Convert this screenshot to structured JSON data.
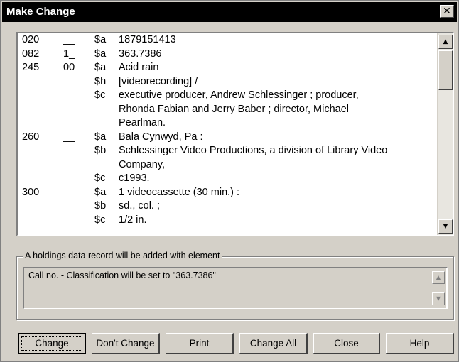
{
  "window": {
    "title": "Make Change",
    "close_glyph": "✕"
  },
  "record": {
    "lines": [
      {
        "tag": "020",
        "ind": "__",
        "sub": "$a",
        "val": "1879151413"
      },
      {
        "tag": "082",
        "ind": "1_",
        "sub": "$a",
        "val": "363.7386"
      },
      {
        "tag": "245",
        "ind": "00",
        "sub": "$a",
        "val": "Acid rain"
      },
      {
        "tag": "",
        "ind": "",
        "sub": "$h",
        "val": "[videorecording] /"
      },
      {
        "tag": "",
        "ind": "",
        "sub": "$c",
        "val": "executive producer, Andrew Schlessinger ; producer,"
      },
      {
        "tag": "",
        "ind": "",
        "sub": "",
        "val": "Rhonda Fabian and Jerry Baber ; director, Michael"
      },
      {
        "tag": "",
        "ind": "",
        "sub": "",
        "val": "Pearlman."
      },
      {
        "tag": "260",
        "ind": "__",
        "sub": "$a",
        "val": "Bala Cynwyd, Pa :"
      },
      {
        "tag": "",
        "ind": "",
        "sub": "$b",
        "val": "Schlessinger Video Productions, a division of Library Video"
      },
      {
        "tag": "",
        "ind": "",
        "sub": "",
        "val": "Company,"
      },
      {
        "tag": "",
        "ind": "",
        "sub": "$c",
        "val": "c1993."
      },
      {
        "tag": "300",
        "ind": "__",
        "sub": "$a",
        "val": "1 videocassette (30 min.) :"
      },
      {
        "tag": "",
        "ind": "",
        "sub": "$b",
        "val": "sd., col. ;"
      },
      {
        "tag": "",
        "ind": "",
        "sub": "$c",
        "val": "1/2 in."
      }
    ]
  },
  "holdings": {
    "legend": "A holdings data record will be added with element",
    "message": "Call no. - Classification will be set to \"363.7386\""
  },
  "buttons": {
    "change": "Change",
    "dont_change": "Don't Change",
    "print": "Print",
    "change_all": "Change All",
    "close": "Close",
    "help": "Help"
  },
  "icons": {
    "scroll_up": "▲",
    "scroll_down": "▼"
  }
}
